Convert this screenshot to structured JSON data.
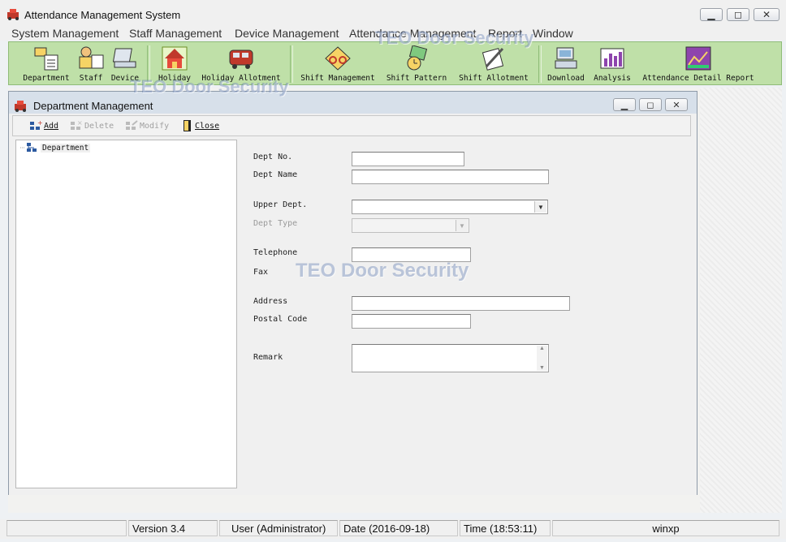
{
  "window": {
    "title": "Attendance Management System"
  },
  "menu": [
    "System Management",
    "Staff Management",
    "Device Management",
    "Attendance Management",
    "Report",
    "Window"
  ],
  "toolbar": {
    "items": [
      "Department",
      "Staff",
      "Device",
      "Holiday",
      "Holiday Allotment",
      "Shift Management",
      "Shift Pattern",
      "Shift Allotment",
      "Download",
      "Analysis",
      "Attendance Detail Report"
    ]
  },
  "watermark": "TEO Door Security",
  "child": {
    "title": "Department Management",
    "toolbar": {
      "add": "Add",
      "delete": "Delete",
      "modify": "Modify",
      "close": "Close"
    },
    "tree": {
      "root": "Department"
    },
    "form": {
      "dept_no": {
        "label": "Dept No.",
        "value": ""
      },
      "dept_name": {
        "label": "Dept Name",
        "value": ""
      },
      "upper_dept": {
        "label": "Upper Dept.",
        "value": ""
      },
      "dept_type": {
        "label": "Dept Type",
        "value": ""
      },
      "telephone": {
        "label": "Telephone",
        "value": ""
      },
      "fax": {
        "label": "Fax",
        "value": ""
      },
      "address": {
        "label": "Address",
        "value": ""
      },
      "postal_code": {
        "label": "Postal Code",
        "value": ""
      },
      "remark": {
        "label": "Remark",
        "value": ""
      }
    }
  },
  "status": {
    "version": "Version 3.4",
    "user": "User (Administrator)",
    "date": "Date (2016-09-18)",
    "time": "Time (18:53:11)",
    "os": "winxp"
  },
  "colors": {
    "toolbar_bg": "#bfe0a8",
    "child_frame": "#d7e0ea"
  }
}
